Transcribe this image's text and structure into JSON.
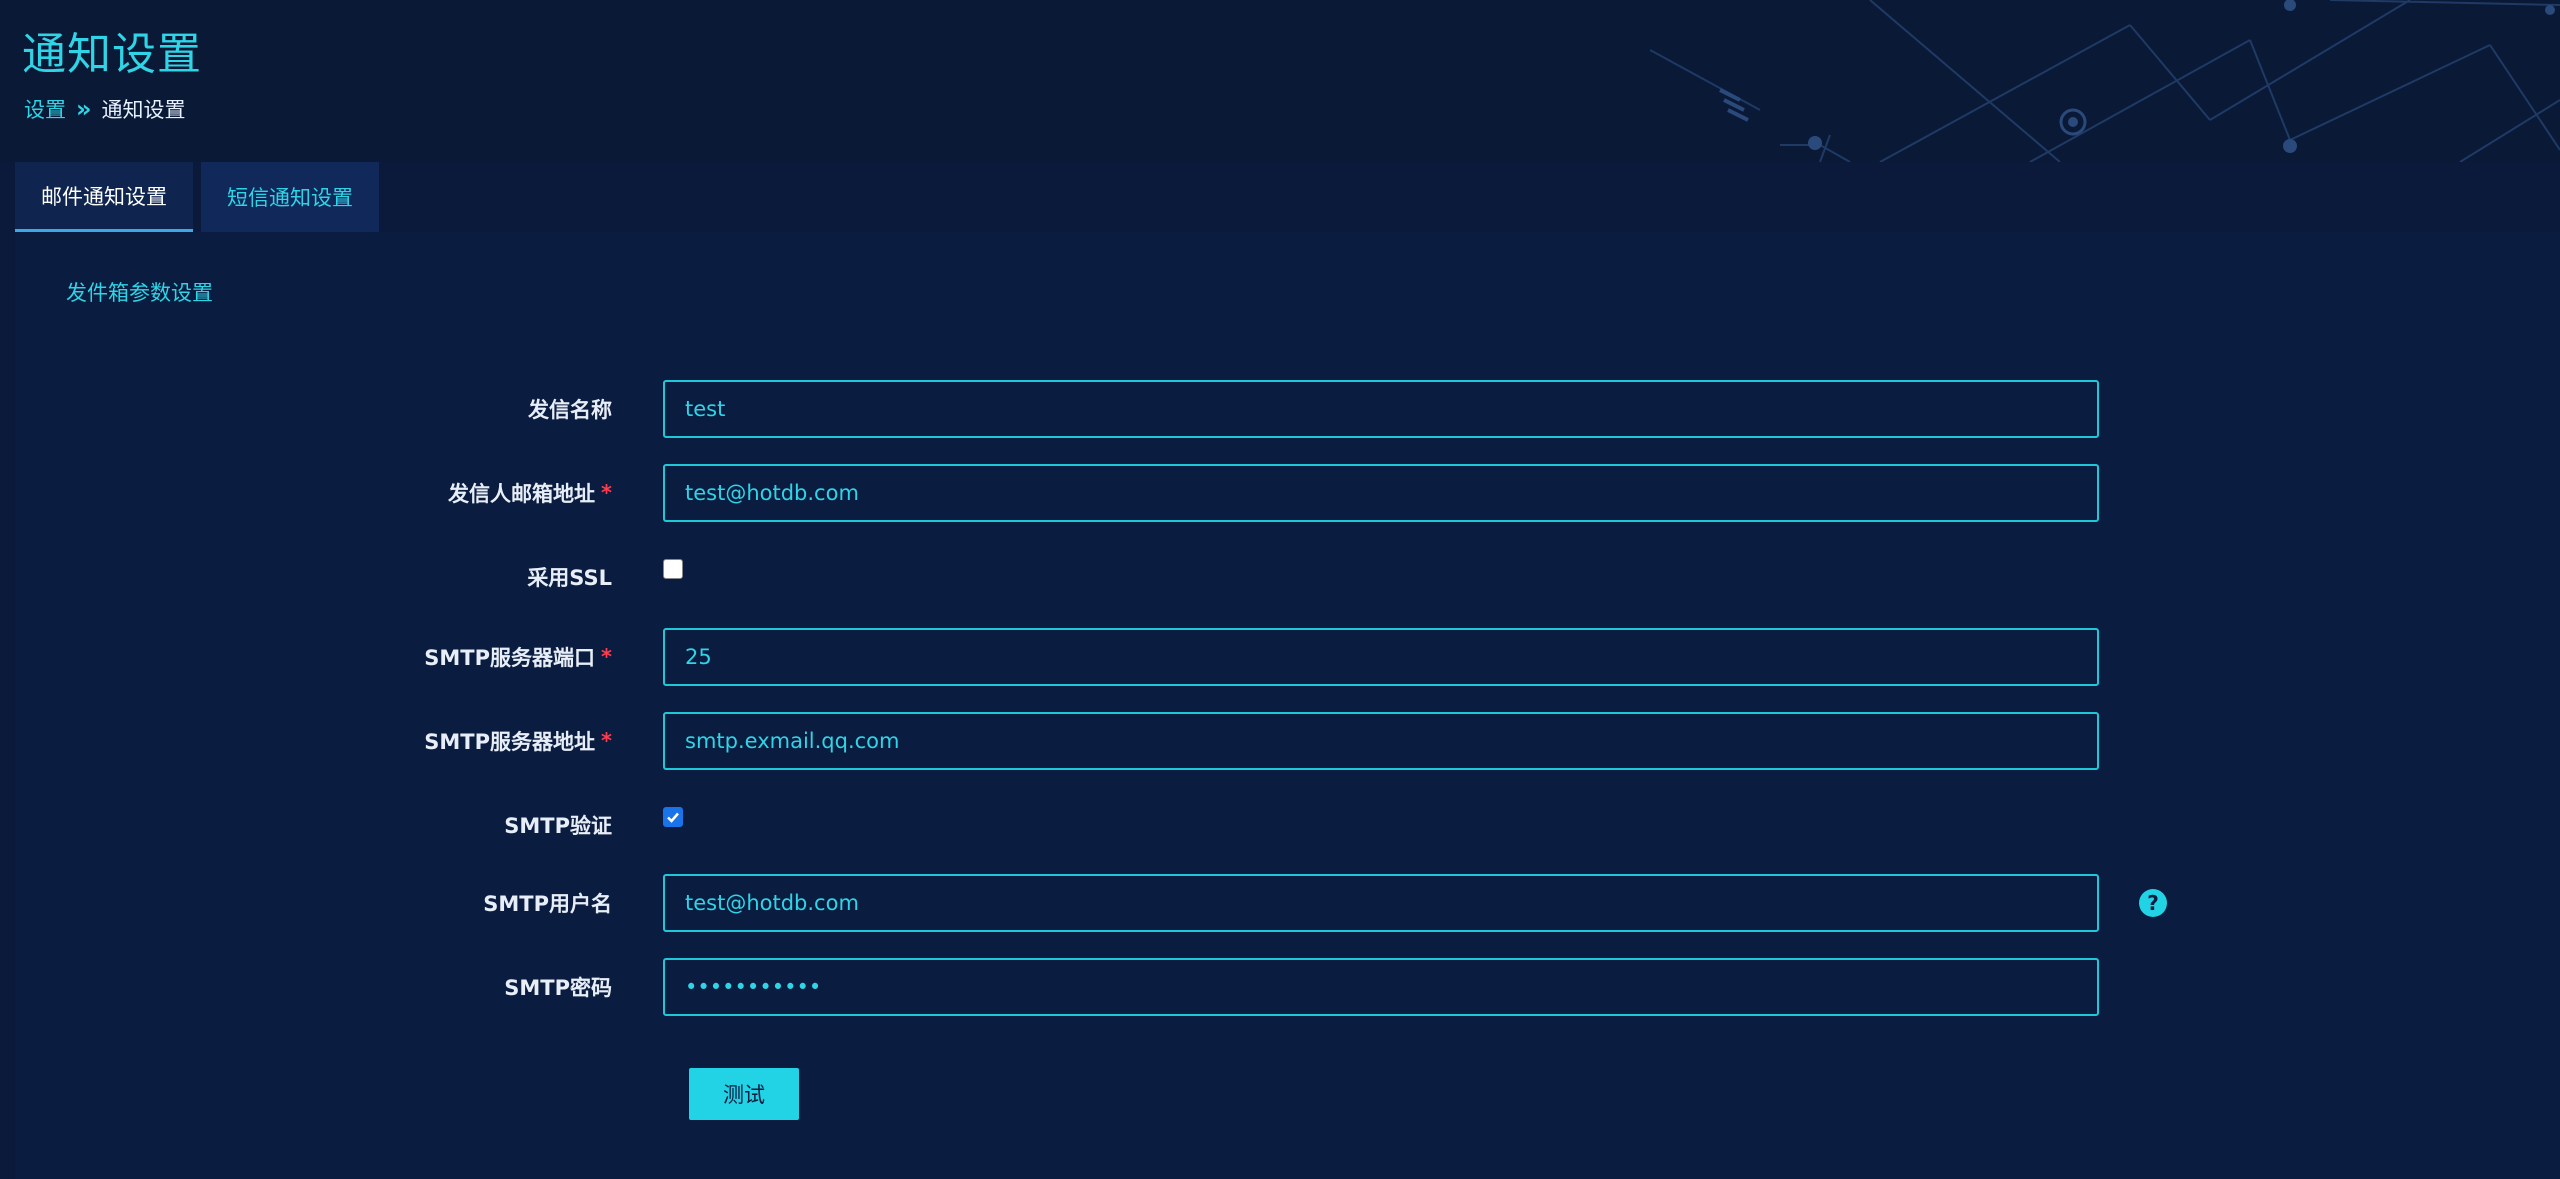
{
  "header": {
    "title": "通知设置",
    "breadcrumb": {
      "parent": "设置",
      "separator": "»",
      "current": "通知设置"
    }
  },
  "tabs": [
    {
      "label": "邮件通知设置",
      "active": true
    },
    {
      "label": "短信通知设置",
      "active": false
    }
  ],
  "section": {
    "title": "发件箱参数设置"
  },
  "form": {
    "sender_name": {
      "label": "发信名称",
      "value": "test",
      "required": false
    },
    "sender_email": {
      "label": "发信人邮箱地址",
      "value": "test@hotdb.com",
      "required": true
    },
    "use_ssl": {
      "label": "采用SSL",
      "checked": false
    },
    "smtp_port": {
      "label": "SMTP服务器端口",
      "value": "25",
      "required": true
    },
    "smtp_host": {
      "label": "SMTP服务器地址",
      "value": "smtp.exmail.qq.com",
      "required": true
    },
    "smtp_auth": {
      "label": "SMTP验证",
      "checked": true
    },
    "smtp_user": {
      "label": "SMTP用户名",
      "value": "test@hotdb.com"
    },
    "smtp_password": {
      "label": "SMTP密码",
      "value": "•••••••••••"
    },
    "required_mark": "*",
    "help_glyph": "?",
    "test_button": "测试"
  },
  "colors": {
    "accent": "#22d3e6",
    "background": "#0b1a3b",
    "required": "#ff3b4e"
  }
}
